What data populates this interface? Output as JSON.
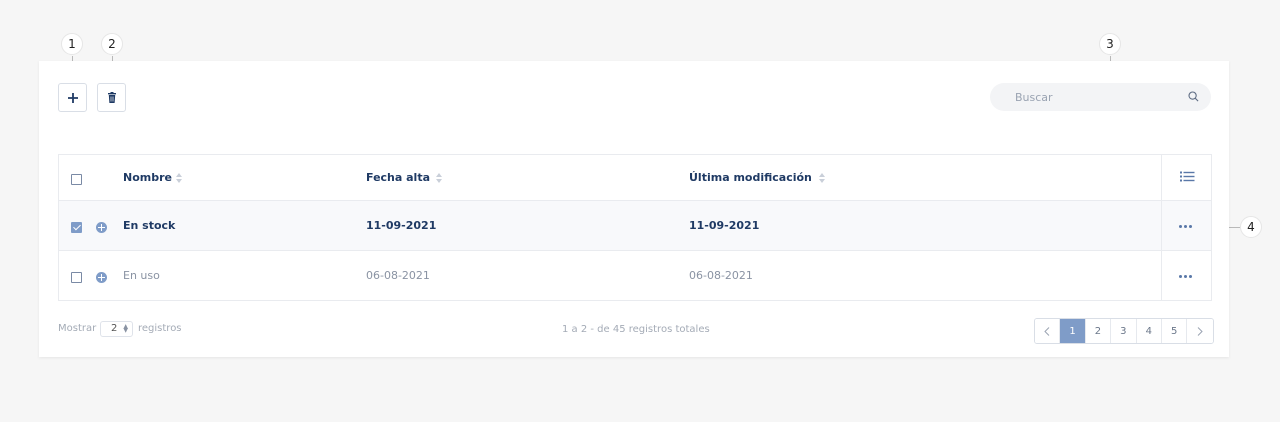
{
  "callouts": [
    "1",
    "2",
    "3",
    "4"
  ],
  "toolbar": {
    "add_icon": "plus-icon",
    "delete_icon": "trash-icon"
  },
  "search": {
    "placeholder": "Buscar",
    "value": "",
    "icon": "search-icon"
  },
  "table": {
    "columns": [
      "Nombre",
      "Fecha alta",
      "Última modificación"
    ],
    "column_menu_icon": "list-icon",
    "rows": [
      {
        "selected": true,
        "name": "En stock",
        "fecha_alta": "11-09-2021",
        "ultima_modificacion": "11-09-2021"
      },
      {
        "selected": false,
        "name": "En uso",
        "fecha_alta": "06-08-2021",
        "ultima_modificacion": "06-08-2021"
      }
    ],
    "row_actions_icon": "more-horizontal-icon"
  },
  "footer": {
    "show_label": "Mostrar",
    "page_size": "2",
    "records_label": "registros",
    "summary": "1 a 2 - de 45 registros totales"
  },
  "pagination": {
    "prev_icon": "chevron-left-icon",
    "pages": [
      "1",
      "2",
      "3",
      "4",
      "5"
    ],
    "current_page": "1",
    "next_icon": "chevron-right-icon"
  },
  "colors": {
    "accent": "#7f9cc8",
    "text_primary": "#1f3a64",
    "background": "#f6f6f6"
  }
}
